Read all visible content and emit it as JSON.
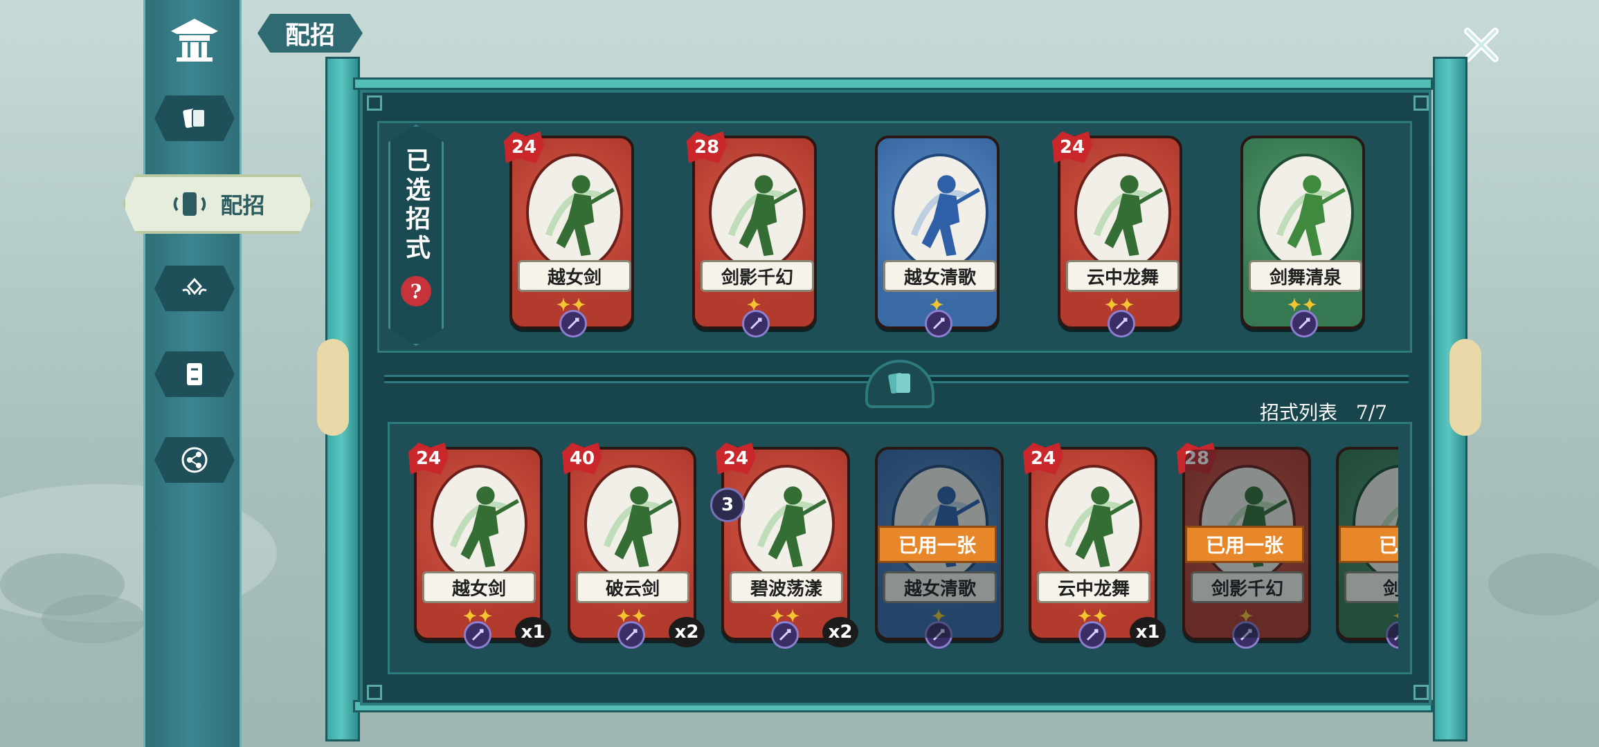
{
  "header": {
    "title": "配招"
  },
  "sidebar": {
    "items": [
      {
        "name": "home",
        "icon": "pavilion-icon"
      },
      {
        "name": "cards",
        "icon": "cards-icon"
      },
      {
        "name": "deck",
        "icon": "deck-swap-icon",
        "label": "配招",
        "active": true
      },
      {
        "name": "skills",
        "icon": "diamond-wings-icon"
      },
      {
        "name": "card-detail",
        "icon": "card-swap-icon"
      },
      {
        "name": "share",
        "icon": "share-icon"
      }
    ]
  },
  "selected_section": {
    "label": "已选招式",
    "help": "?"
  },
  "selected_cards": [
    {
      "name": "越女剑",
      "cost": 24,
      "color": "red",
      "stars": "✦✦",
      "type": "sword"
    },
    {
      "name": "剑影千幻",
      "cost": 28,
      "color": "red",
      "stars": "✦",
      "type": "sword"
    },
    {
      "name": "越女清歌",
      "cost": null,
      "color": "blue",
      "stars": "✦",
      "type": "axe"
    },
    {
      "name": "云中龙舞",
      "cost": 24,
      "color": "red",
      "stars": "✦✦",
      "type": "sword"
    },
    {
      "name": "剑舞清泉",
      "cost": null,
      "color": "green",
      "stars": "✦✦",
      "type": "bell"
    }
  ],
  "list_section": {
    "label": "招式列表",
    "count": "7/7"
  },
  "list_cards": [
    {
      "name": "越女剑",
      "cost": 24,
      "color": "red",
      "stars": "✦✦",
      "qty": "x1",
      "used": false
    },
    {
      "name": "破云剑",
      "cost": 40,
      "color": "red",
      "stars": "✦✦",
      "qty": "x2",
      "used": false
    },
    {
      "name": "碧波荡漾",
      "cost": 24,
      "color": "red",
      "stars": "✦✦",
      "qty": "x2",
      "stack": "3",
      "used": false
    },
    {
      "name": "越女清歌",
      "cost": null,
      "color": "blue",
      "stars": "✦",
      "qty": "",
      "used": true,
      "used_label": "已用一张"
    },
    {
      "name": "云中龙舞",
      "cost": 24,
      "color": "red",
      "stars": "✦✦",
      "qty": "x1",
      "used": false
    },
    {
      "name": "剑影千幻",
      "cost": 28,
      "color": "red",
      "stars": "✦",
      "qty": "",
      "used": true,
      "used_label": "已用一张"
    },
    {
      "name": "剑舞",
      "cost": null,
      "color": "green",
      "stars": "✦",
      "qty": "",
      "used": true,
      "used_label": "已用"
    }
  ],
  "colors": {
    "frame": "#53bdb6",
    "panel": "#18444b",
    "card_red": "#b23b2e",
    "card_blue": "#3a6aa4",
    "card_green": "#357851",
    "used_tag": "#e8872a"
  }
}
